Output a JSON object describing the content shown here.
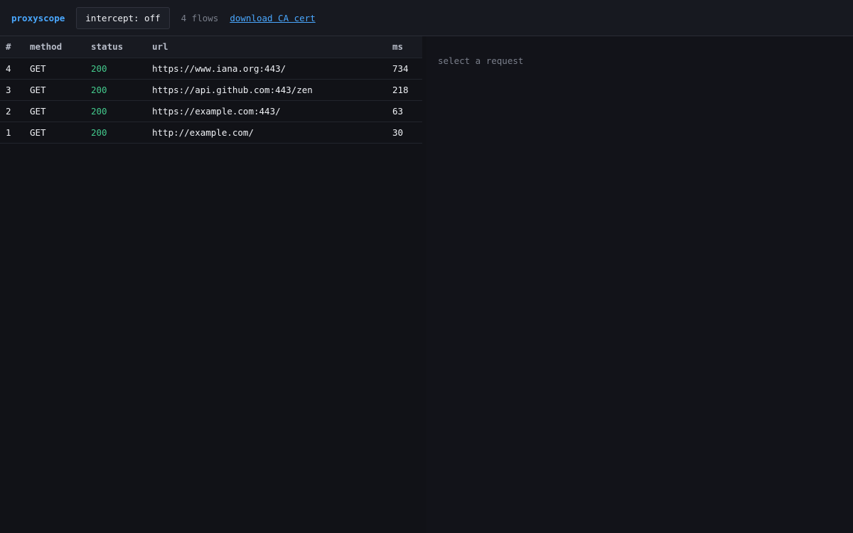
{
  "app": {
    "brand": "proxyscope",
    "intercept_label": "intercept: off",
    "flows_label": "4 flows",
    "cert_link": "download CA cert"
  },
  "table": {
    "headers": [
      "#",
      "method",
      "status",
      "url",
      "ms"
    ],
    "rows": [
      {
        "num": "4",
        "method": "GET",
        "status": "200",
        "url": "https://www.iana.org:443/",
        "ms": "734"
      },
      {
        "num": "3",
        "method": "GET",
        "status": "200",
        "url": "https://api.github.com:443/zen",
        "ms": "218"
      },
      {
        "num": "2",
        "method": "GET",
        "status": "200",
        "url": "https://example.com:443/",
        "ms": "63"
      },
      {
        "num": "1",
        "method": "GET",
        "status": "200",
        "url": "http://example.com/",
        "ms": "30"
      }
    ]
  },
  "detail": {
    "placeholder": "select a request"
  },
  "colors": {
    "accent": "#4aa8ff",
    "status_ok": "#43c98c",
    "background": "#111217"
  }
}
